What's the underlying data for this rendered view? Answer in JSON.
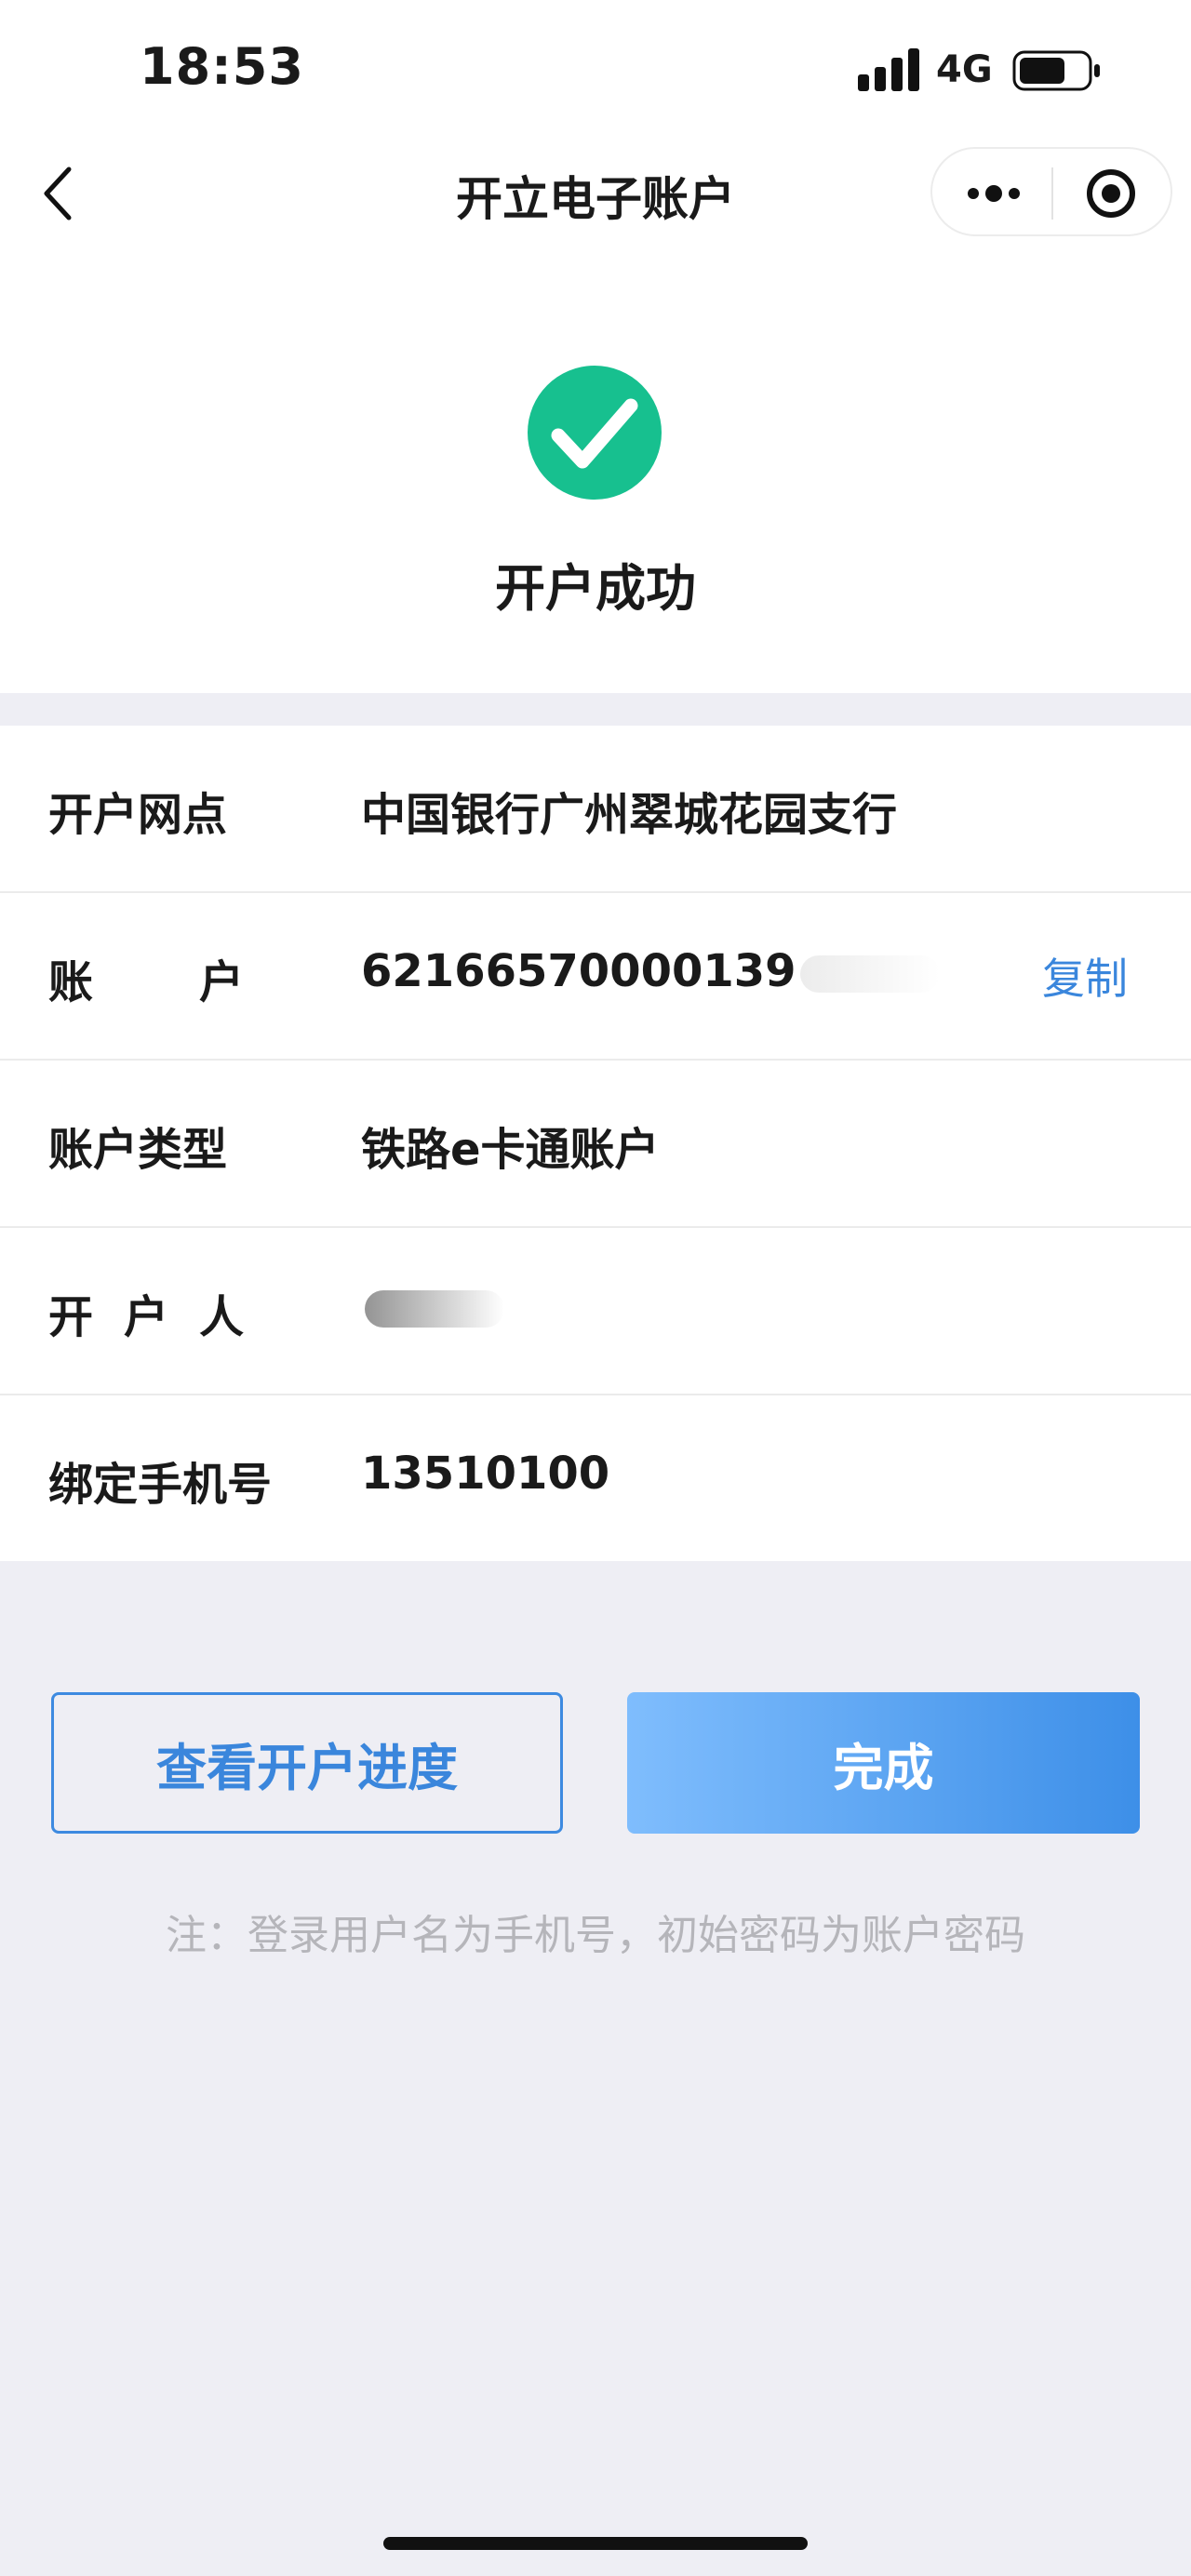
{
  "status_bar": {
    "time": "18:53",
    "network": "4G",
    "icons": [
      "signal-icon",
      "battery-icon"
    ]
  },
  "nav": {
    "title": "开立电子账户",
    "icons": [
      "back-icon",
      "more-icon",
      "close-icon"
    ]
  },
  "success": {
    "title": "开户成功",
    "icon": "check-circle-icon",
    "icon_color": "#17c08f"
  },
  "info": {
    "branch_label": "开户网点",
    "branch_value": "中国银行广州翠城花园支行",
    "account_label_a": "账",
    "account_label_b": "户",
    "account_value": "62166570000139",
    "copy_label": "复制",
    "type_label": "账户类型",
    "type_value": "铁路e卡通账户",
    "holder_label_a": "开",
    "holder_label_b": "户",
    "holder_label_c": "人",
    "phone_label": "绑定手机号",
    "phone_value": "13510100"
  },
  "actions": {
    "progress_label": "查看开户进度",
    "done_label": "完成"
  },
  "note": "注：登录用户名为手机号，初始密码为账户密码",
  "colors": {
    "accent": "#3a86dc",
    "success": "#17c08f",
    "page_bg": "#eeeef4"
  }
}
